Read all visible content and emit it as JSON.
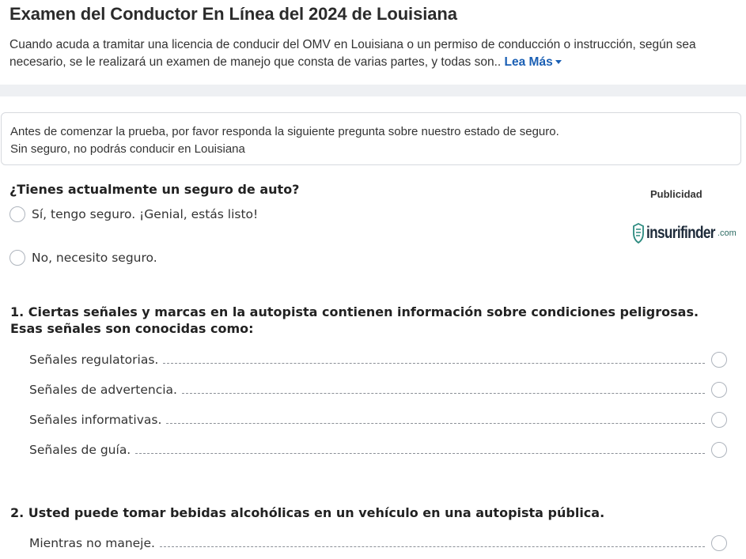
{
  "header": {
    "title": "Examen del Conductor En Línea del 2024 de Louisiana",
    "intro": "Cuando acuda a tramitar una licencia de conducir del OMV en Louisiana o un permiso de conducción o instrucción, según sea necesario, se le realizará un examen de manejo que consta de varias partes, y todas son..",
    "read_more": "Lea Más"
  },
  "notice": {
    "line1": "Antes de comenzar la prueba, por favor responda la siguiente pregunta sobre nuestro estado de seguro.",
    "line2": "Sin seguro, no podrás conducir en Louisiana"
  },
  "insurance": {
    "question": "¿Tienes actualmente un seguro de auto?",
    "options": [
      "Sí, tengo seguro. ¡Genial, estás listo!",
      "No, necesito seguro."
    ]
  },
  "ad": {
    "label": "Publicidad",
    "logo_main": "insurifinder",
    "logo_suffix": ".com",
    "icon": "shield-icon"
  },
  "questions": [
    {
      "title": "1. Ciertas señales y marcas en la autopista contienen información sobre condiciones peligrosas. Esas señales son conocidas como:",
      "answers": [
        "Señales regulatorias.",
        "Señales de advertencia.",
        "Señales informativas.",
        "Señales de guía."
      ]
    },
    {
      "title": "2. Usted puede tomar bebidas alcohólicas en un vehículo en una autopista pública.",
      "answers": [
        "Mientras no maneje."
      ]
    }
  ],
  "colors": {
    "link": "#1a5fb4",
    "band": "#eef0f3",
    "radio_border": "#aeb4bd"
  }
}
